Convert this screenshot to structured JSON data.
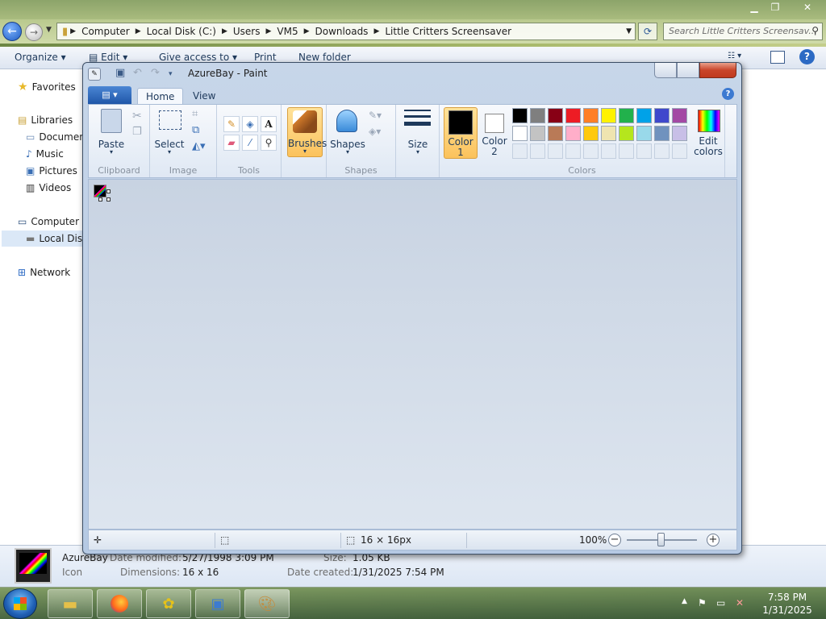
{
  "explorer": {
    "breadcrumb": [
      "Computer",
      "Local Disk (C:)",
      "Users",
      "VM5",
      "Downloads",
      "Little Critters Screensaver"
    ],
    "search_placeholder": "Search Little Critters Screensav...",
    "toolbar": {
      "organize": "Organize",
      "edit": "Edit",
      "give_access": "Give access to",
      "print": "Print",
      "new_folder": "New folder"
    },
    "nav": {
      "favorites": "Favorites",
      "libraries": "Libraries",
      "documents": "Documents",
      "music": "Music",
      "pictures": "Pictures",
      "videos": "Videos",
      "computer": "Computer",
      "local_disk": "Local Disk",
      "network": "Network"
    },
    "details": {
      "name": "AzureBay",
      "type": "Icon",
      "date_modified_label": "Date modified:",
      "date_modified": "5/27/1998 3:09 PM",
      "dimensions_label": "Dimensions:",
      "dimensions": "16 x 16",
      "size_label": "Size:",
      "size": "1.05 KB",
      "date_created_label": "Date created:",
      "date_created": "1/31/2025 7:54 PM"
    }
  },
  "paint": {
    "title": "AzureBay - Paint",
    "tabs": {
      "home": "Home",
      "view": "View"
    },
    "groups": {
      "clipboard": "Clipboard",
      "image": "Image",
      "tools": "Tools",
      "shapes": "Shapes",
      "colors": "Colors"
    },
    "buttons": {
      "paste": "Paste",
      "select": "Select",
      "brushes": "Brushes",
      "shapes": "Shapes",
      "size": "Size",
      "color1": "Color\n1",
      "color2": "Color\n2",
      "edit_colors": "Edit\ncolors"
    },
    "color1_value": "#000000",
    "color2_value": "#ffffff",
    "palette_row1": [
      "#000000",
      "#7f7f7f",
      "#880015",
      "#ed1c24",
      "#ff7f27",
      "#fff200",
      "#22b14c",
      "#00a2e8",
      "#3f48cc",
      "#a349a4"
    ],
    "palette_row2": [
      "#ffffff",
      "#c3c3c3",
      "#b97a57",
      "#ffaec9",
      "#ffc90e",
      "#efe4b0",
      "#b5e61d",
      "#99d9ea",
      "#7092be",
      "#c8bfe7"
    ],
    "status": {
      "image_size": "16 × 16px",
      "zoom": "100%"
    }
  },
  "taskbar": {
    "time": "7:58 PM",
    "date": "1/31/2025"
  }
}
